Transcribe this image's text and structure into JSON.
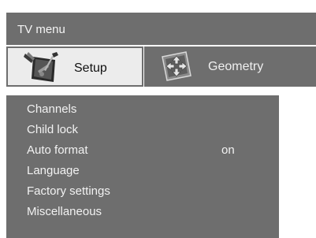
{
  "menu": {
    "title": "TV menu"
  },
  "tabs": [
    {
      "label": "Setup",
      "icon": "setup-tools-icon",
      "selected": true
    },
    {
      "label": "Geometry",
      "icon": "geometry-arrows-icon",
      "selected": false
    }
  ],
  "items": [
    {
      "label": "Channels",
      "value": ""
    },
    {
      "label": "Child lock",
      "value": ""
    },
    {
      "label": "Auto format",
      "value": "on"
    },
    {
      "label": "Language",
      "value": ""
    },
    {
      "label": "Factory settings",
      "value": ""
    },
    {
      "label": "Miscellaneous",
      "value": ""
    }
  ],
  "colors": {
    "panel": "#6e6e6e",
    "selected_tab": "#ececec",
    "text_light": "#f2f2f2",
    "text_dark": "#111111"
  }
}
